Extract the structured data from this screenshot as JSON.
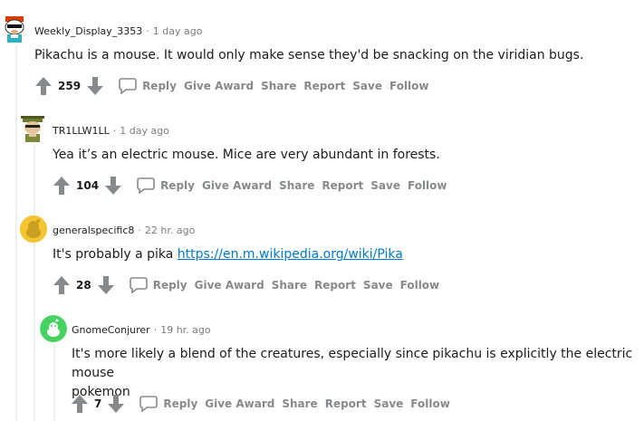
{
  "comments": [
    {
      "author": "Weekly_Display_3353",
      "time": "1 day ago",
      "body": "Pikachu is a mouse. It would only make sense they'd be snacking on the viridian bugs.",
      "score": "259"
    },
    {
      "author": "TR1LLW1LL",
      "time": "1 day ago",
      "body": "Yea it’s an electric mouse. Mice are very abundant in forests.",
      "score": "104"
    },
    {
      "author": "generalspecific8",
      "time": "22 hr. ago",
      "body_prefix": "It's probably a pika ",
      "link_text": "https://en.m.wikipedia.org/wiki/Pika",
      "score": "28"
    },
    {
      "author": "GnomeConjurer",
      "time": "19 hr. ago",
      "body_line1": "It's more likely a blend of the creatures, especially since pikachu is explicitly the electric mouse",
      "body_line2": "pokemon",
      "score": "7"
    }
  ],
  "actions": {
    "reply": "Reply",
    "give_award": "Give Award",
    "share": "Share",
    "report": "Report",
    "save": "Save",
    "follow": "Follow"
  },
  "separator": "·",
  "colors": {
    "link": "#0079d3",
    "action_gray": "#878a8c",
    "thread_line": "#edeff1"
  },
  "icons": [
    "upvote-icon",
    "downvote-icon",
    "reply-bubble-icon"
  ]
}
